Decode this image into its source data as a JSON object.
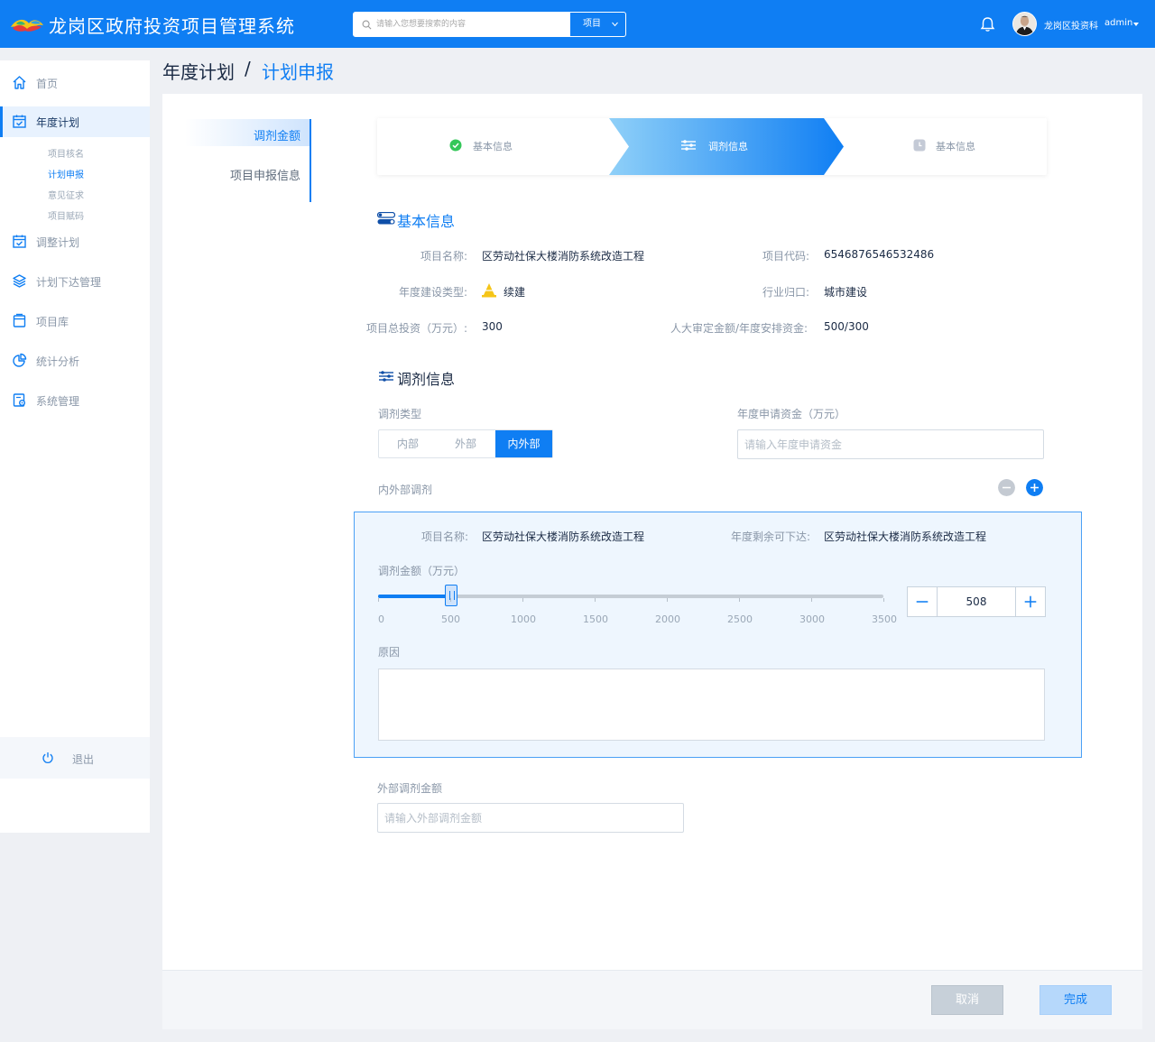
{
  "app": {
    "title": "龙岗区政府投资项目管理系统"
  },
  "search": {
    "placeholder": "请输入您想要搜索的内容",
    "scope": "项目"
  },
  "user": {
    "name": "龙岗区投资科",
    "role": "admin"
  },
  "sidebar": {
    "items": [
      {
        "label": "首页",
        "icon": "home-icon"
      },
      {
        "label": "年度计划",
        "icon": "calendar-check-icon",
        "active": true
      },
      {
        "label": "调整计划",
        "icon": "calendar-edit-icon"
      },
      {
        "label": "计划下达管理",
        "icon": "layers-icon"
      },
      {
        "label": "项目库",
        "icon": "archive-icon"
      },
      {
        "label": "统计分析",
        "icon": "pie-chart-icon"
      },
      {
        "label": "系统管理",
        "icon": "settings-doc-icon"
      }
    ],
    "sub_items": [
      {
        "label": "项目核名"
      },
      {
        "label": "计划申报",
        "active": true
      },
      {
        "label": "意见征求"
      },
      {
        "label": "项目赋码"
      }
    ],
    "logout": "退出"
  },
  "breadcrumb": {
    "parent": "年度计划",
    "separator": "/",
    "current": "计划申报"
  },
  "vtabs": [
    {
      "label": "调剂金额",
      "active": true
    },
    {
      "label": "项目申报信息"
    }
  ],
  "steps": [
    {
      "label": "基本信息",
      "state": "done"
    },
    {
      "label": "调剂信息",
      "state": "active"
    },
    {
      "label": "基本信息",
      "state": "pending"
    }
  ],
  "basic": {
    "title": "基本信息",
    "project_name_label": "项目名称:",
    "project_name": "区劳动社保大楼消防系统改造工程",
    "project_code_label": "项目代码:",
    "project_code": "6546876546532486",
    "build_type_label": "年度建设类型:",
    "build_type": "续建",
    "industry_label": "行业归口:",
    "industry": "城市建设",
    "total_invest_label": "项目总投资（万元）:",
    "total_invest": "300",
    "approved_label": "人大审定金额/年度安排资金:",
    "approved": "500/300"
  },
  "adjust": {
    "title": "调剂信息",
    "type_label": "调剂类型",
    "type_options": [
      "内部",
      "外部",
      "内外部"
    ],
    "type_selected": "内外部",
    "apply_label": "年度申请资金（万元）",
    "apply_placeholder": "请输入年度申请资金",
    "mixed_label": "内外部调剂",
    "panel": {
      "project_name_label": "项目名称:",
      "project_name": "区劳动社保大楼消防系统改造工程",
      "remaining_label": "年度剩余可下达:",
      "remaining": "区劳动社保大楼消防系统改造工程",
      "amount_label": "调剂金额（万元）",
      "slider": {
        "min": 0,
        "max": 3500,
        "value": 508,
        "ticks": [
          "0",
          "500",
          "1000",
          "1500",
          "2000",
          "2500",
          "3000",
          "3500"
        ]
      },
      "amount_value": "508",
      "reason_label": "原因"
    },
    "external_label": "外部调剂金额",
    "external_placeholder": "请输入外部调剂金额"
  },
  "footer": {
    "cancel": "取消",
    "done": "完成"
  },
  "colors": {
    "primary": "#0f7ef3",
    "sidebar_active_bg": "#e8f2fe",
    "panel_bg": "#eef6fe"
  }
}
